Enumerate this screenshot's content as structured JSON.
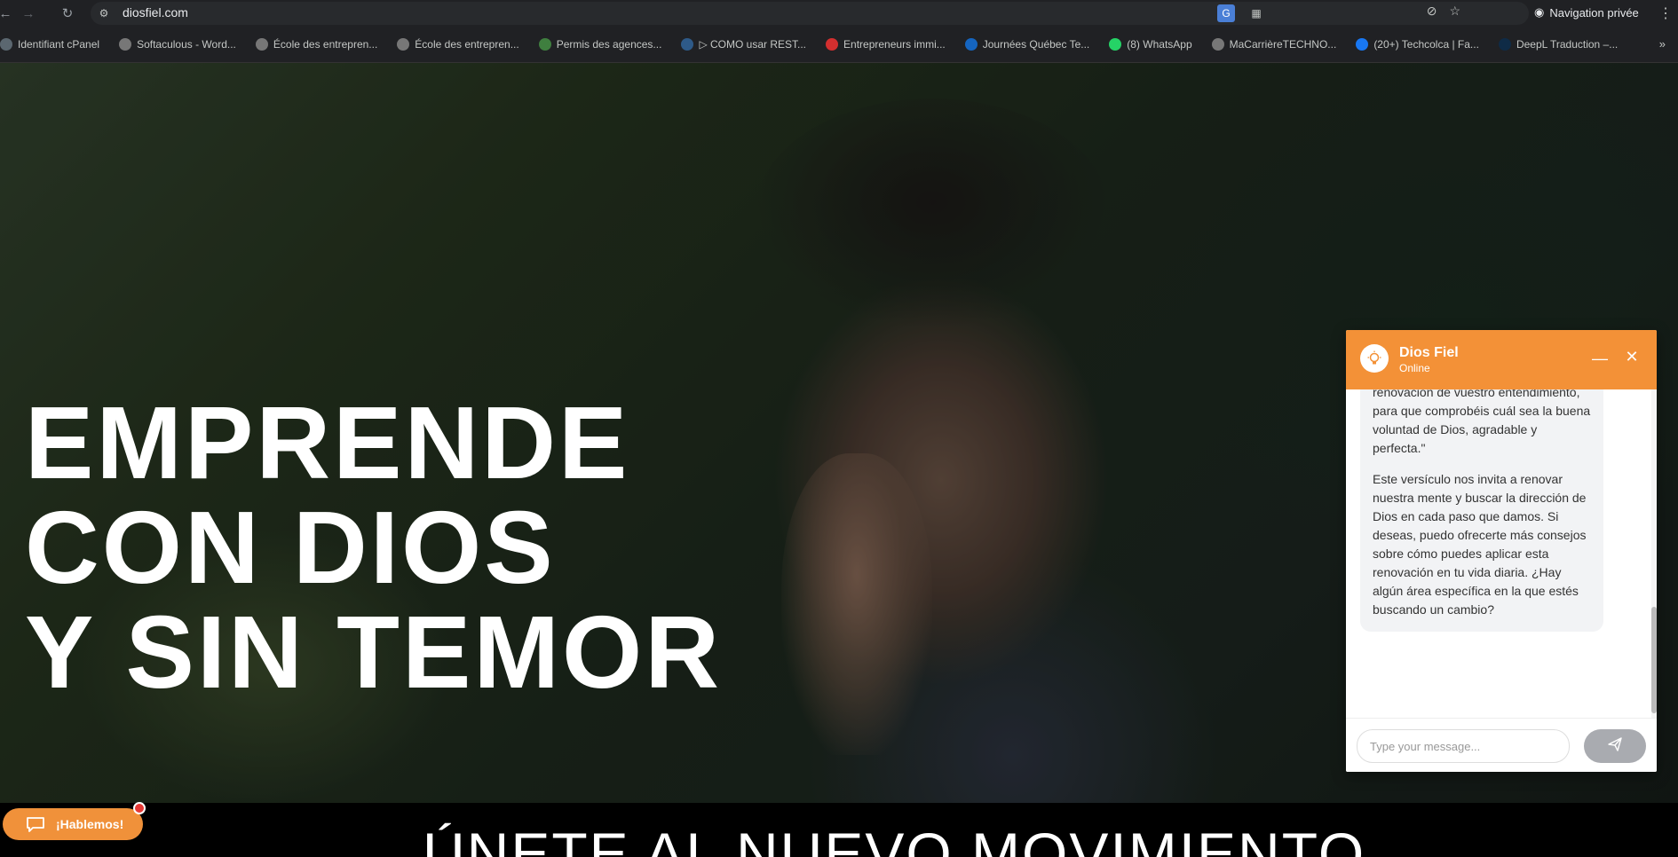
{
  "browser": {
    "url": "diosfiel.com",
    "private_label": "Navigation privée",
    "icons": [
      "back-arrow-icon",
      "forward-arrow-icon",
      "reload-icon",
      "site-info-icon",
      "eye-off-icon",
      "star-icon",
      "google-translate-icon",
      "extensions-icon",
      "incognito-icon",
      "menu-dots-icon"
    ]
  },
  "bookmarks": [
    {
      "label": "Identifiant cPanel",
      "icon": "cpanel-icon",
      "color": "#5b6770"
    },
    {
      "label": "Softaculous - Word...",
      "icon": "globe-icon",
      "color": "#777777"
    },
    {
      "label": "École des entrepren...",
      "icon": "globe-icon",
      "color": "#777777"
    },
    {
      "label": "École des entrepren...",
      "icon": "globe-icon",
      "color": "#777777"
    },
    {
      "label": "Permis des agences...",
      "icon": "agency-icon",
      "color": "#3f7f3f"
    },
    {
      "label": "▷ COMO usar REST...",
      "icon": "rest-icon",
      "color": "#2e5a88"
    },
    {
      "label": "Entrepreneurs immi...",
      "icon": "e-icon",
      "color": "#d32f2f"
    },
    {
      "label": "Journées Québec Te...",
      "icon": "quebec-icon",
      "color": "#1565c0"
    },
    {
      "label": "(8) WhatsApp",
      "icon": "whatsapp-icon",
      "color": "#25d366"
    },
    {
      "label": "MaCarrièreTECHNO...",
      "icon": "globe-icon",
      "color": "#777777"
    },
    {
      "label": "(20+) Techcolca | Fa...",
      "icon": "facebook-icon",
      "color": "#1877f2"
    },
    {
      "label": "DeepL Traduction –...",
      "icon": "deepl-icon",
      "color": "#0f2b46"
    }
  ],
  "hero": {
    "line1": "EMPRENDE",
    "line2": "CON DIOS",
    "line3": "Y SIN TEMOR"
  },
  "band": {
    "text": "ÚNETE AL NUEVO MOVIMIENTO"
  },
  "launcher": {
    "label": "¡Hablemos!",
    "icon": "chat-bubble-icon"
  },
  "chat": {
    "title": "Dios Fiel",
    "status": "Online",
    "avatar_icon": "lightbulb-icon",
    "message_part1": "transformaos por medio de la renovación de vuestro entendimiento, para que comprobéis cuál sea la buena voluntad de Dios, agradable y perfecta.\"",
    "message_part2": "Este versículo nos invita a renovar nuestra mente y buscar la dirección de Dios en cada paso que damos. Si deseas, puedo ofrecerte más consejos sobre cómo puedes aplicar esta renovación en tu vida diaria. ¿Hay algún área específica en la que estés buscando un cambio?",
    "input_placeholder": "Type your message...",
    "input_value": "",
    "accent_color": "#f39137",
    "send_icon": "send-icon"
  }
}
